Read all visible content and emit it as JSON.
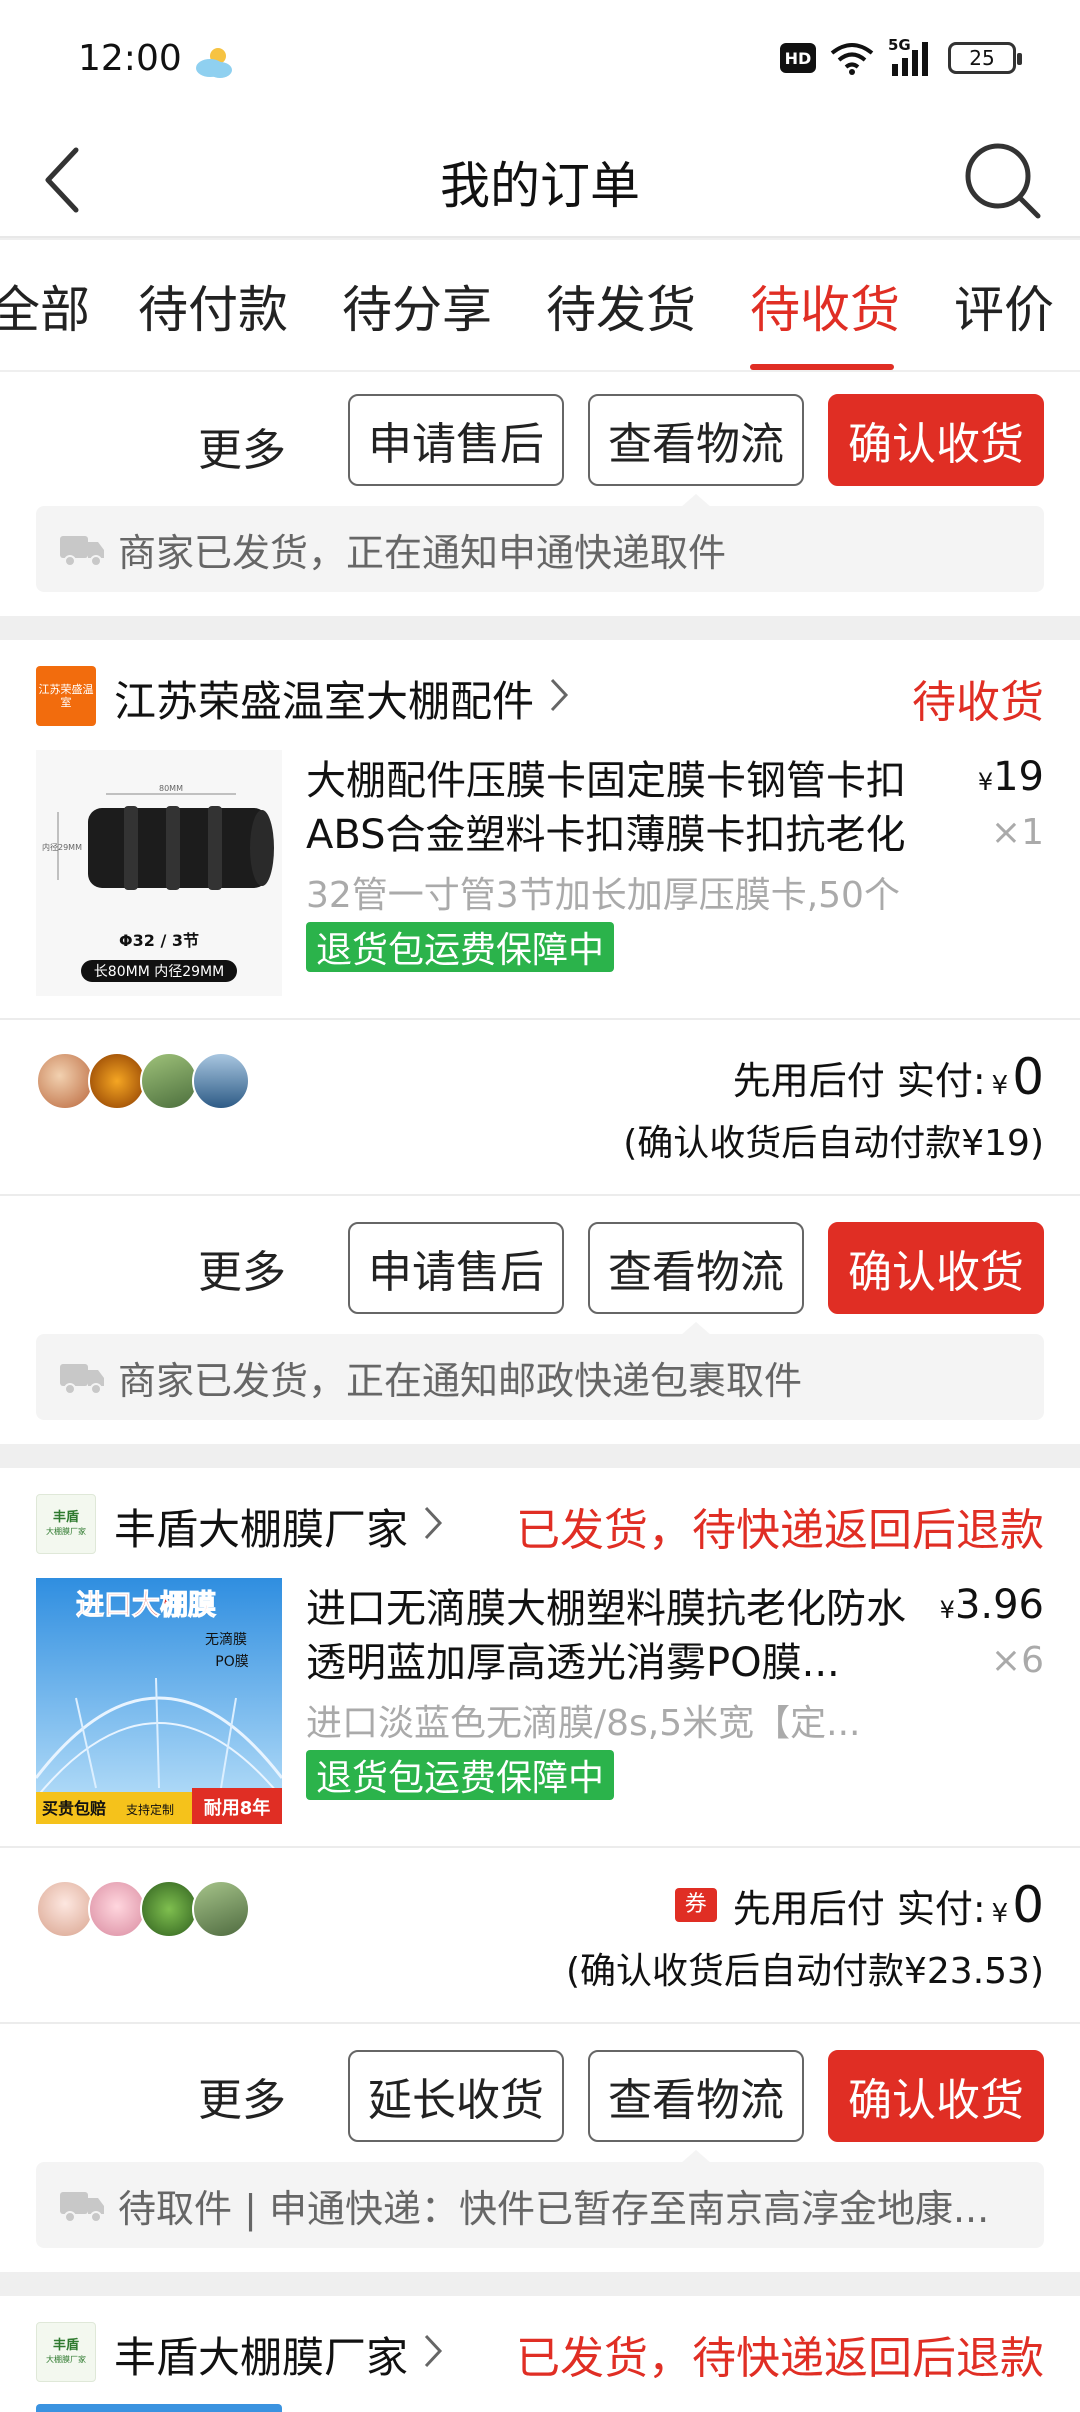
{
  "status_bar": {
    "time": "12:00",
    "weather_icon": "partly-cloudy-icon",
    "hd": "HD",
    "network": "5G",
    "battery": "25"
  },
  "nav": {
    "title": "我的订单",
    "back_icon": "back-chevron-icon",
    "search_icon": "search-icon"
  },
  "tabs": [
    "全部",
    "待付款",
    "待分享",
    "待发货",
    "待收货",
    "评价"
  ],
  "active_tab": "待收货",
  "colors": {
    "accent": "#e02e24",
    "guarantee": "#2bb34b",
    "muted": "#aaaaaa"
  },
  "orders": [
    {
      "actions": {
        "more": "更多",
        "btn1": "申请售后",
        "btn2": "查看物流",
        "btn3": "确认收货"
      },
      "notice": "商家已发货，正在通知申通快递取件"
    },
    {
      "shop": {
        "name": "江苏荣盛温室大棚配件",
        "logo_text": "江苏荣盛温室"
      },
      "status": "待收货",
      "product": {
        "title": "大棚配件压膜卡固定膜卡钢管卡扣ABS合金塑料卡扣薄膜卡扣抗老化",
        "spec": "32管一寸管3节加长加厚压膜卡,50个",
        "guarantee": "退货包运费保障中",
        "price_symbol": "¥",
        "price": "19",
        "qty": "×1",
        "thumb_label_1": "Φ32 / 3节",
        "thumb_label_2": "长80MM 内径29MM",
        "thumb_dim_1": "80MM",
        "thumb_dim_2": "内径29MM"
      },
      "payment": {
        "label": "先用后付 实付:",
        "yen": "¥",
        "amount": "0",
        "auto_pay": "(确认收货后自动付款¥19)"
      },
      "actions": {
        "more": "更多",
        "btn1": "申请售后",
        "btn2": "查看物流",
        "btn3": "确认收货"
      },
      "notice": "商家已发货，正在通知邮政快递包裹取件"
    },
    {
      "shop": {
        "name": "丰盾大棚膜厂家",
        "logo_text_1": "丰盾",
        "logo_text_2": "大棚膜厂家"
      },
      "status": "已发货，待快递返回后退款",
      "product": {
        "title": "进口无滴膜大棚塑料膜抗老化防水透明蓝加厚高透光消雾PO膜...",
        "spec": "进口淡蓝色无滴膜/8s,5米宽【定...",
        "guarantee": "退货包运费保障中",
        "price_symbol": "¥",
        "price": "3.96",
        "qty": "×6",
        "thumb_title": "进口大棚膜",
        "thumb_sub_1": "无滴膜",
        "thumb_sub_2": "PO膜",
        "thumb_foot_1": "买贵包赔",
        "thumb_foot_2": "支持定制",
        "thumb_foot_3": "耐用8年"
      },
      "payment": {
        "coupon": "券",
        "label": "先用后付 实付:",
        "yen": "¥",
        "amount": "0",
        "auto_pay": "(确认收货后自动付款¥23.53)"
      },
      "actions": {
        "more": "更多",
        "btn1": "延长收货",
        "btn2": "查看物流",
        "btn3": "确认收货"
      },
      "notice": "待取件 | 申通快递：快件已暂存至南京高淳金地康..."
    },
    {
      "shop": {
        "name": "丰盾大棚膜厂家",
        "logo_text_1": "丰盾",
        "logo_text_2": "大棚膜厂家"
      },
      "status": "已发货，待快递返回后退款"
    }
  ]
}
